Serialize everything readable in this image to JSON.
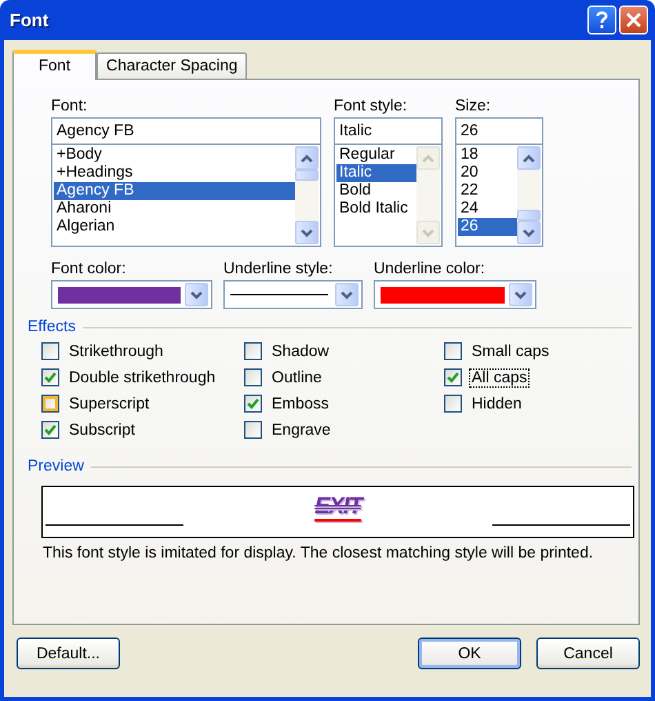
{
  "window": {
    "title": "Font"
  },
  "tabs": [
    {
      "label": "Font",
      "selected": true
    },
    {
      "label": "Character Spacing",
      "selected": false
    }
  ],
  "lists": [
    {
      "label": "Font:",
      "value": "Agency FB",
      "scrollbar_enabled": true,
      "items": [
        {
          "label": "+Body",
          "selected": false
        },
        {
          "label": "+Headings",
          "selected": false
        },
        {
          "label": "Agency FB",
          "selected": true
        },
        {
          "label": "Aharoni",
          "selected": false
        },
        {
          "label": "Algerian",
          "selected": false
        }
      ]
    },
    {
      "label": "Font style:",
      "value": "Italic",
      "scrollbar_enabled": false,
      "items": [
        {
          "label": "Regular",
          "selected": false
        },
        {
          "label": "Italic",
          "selected": true
        },
        {
          "label": "Bold",
          "selected": false
        },
        {
          "label": "Bold Italic",
          "selected": false
        }
      ]
    },
    {
      "label": "Size:",
      "value": "26",
      "scrollbar_enabled": true,
      "items": [
        {
          "label": "18",
          "selected": false
        },
        {
          "label": "20",
          "selected": false
        },
        {
          "label": "22",
          "selected": false
        },
        {
          "label": "24",
          "selected": false
        },
        {
          "label": "26",
          "selected": true
        }
      ]
    }
  ],
  "dropdowns": [
    {
      "label": "Font color:",
      "kind": "color",
      "color": "#7030a0"
    },
    {
      "label": "Underline style:",
      "kind": "line"
    },
    {
      "label": "Underline color:",
      "kind": "color",
      "color": "#ff0000"
    }
  ],
  "effects": {
    "title": "Effects",
    "columns": [
      {
        "items": [
          {
            "label": "Strikethrough",
            "checked": false,
            "hovered": false,
            "focused": false
          },
          {
            "label": "Double strikethrough",
            "checked": true,
            "hovered": false,
            "focused": false
          },
          {
            "label": "Superscript",
            "checked": false,
            "hovered": true,
            "focused": false
          },
          {
            "label": "Subscript",
            "checked": true,
            "hovered": false,
            "focused": false
          }
        ]
      },
      {
        "items": [
          {
            "label": "Shadow",
            "checked": false,
            "hovered": false,
            "focused": false
          },
          {
            "label": "Outline",
            "checked": false,
            "hovered": false,
            "focused": false
          },
          {
            "label": "Emboss",
            "checked": true,
            "hovered": false,
            "focused": false
          },
          {
            "label": "Engrave",
            "checked": false,
            "hovered": false,
            "focused": false
          }
        ]
      },
      {
        "items": [
          {
            "label": "Small caps",
            "checked": false,
            "hovered": false,
            "focused": false
          },
          {
            "label": "All caps",
            "checked": true,
            "hovered": false,
            "focused": true
          },
          {
            "label": "Hidden",
            "checked": false,
            "hovered": false,
            "focused": false
          }
        ]
      }
    ]
  },
  "preview": {
    "title": "Preview",
    "sample": "EXIT",
    "note": "This font style is imitated for display. The closest matching style will be printed."
  },
  "buttons": [
    {
      "label": "Default...",
      "default": false
    },
    {
      "label": "OK",
      "default": true
    },
    {
      "label": "Cancel",
      "default": false
    }
  ]
}
